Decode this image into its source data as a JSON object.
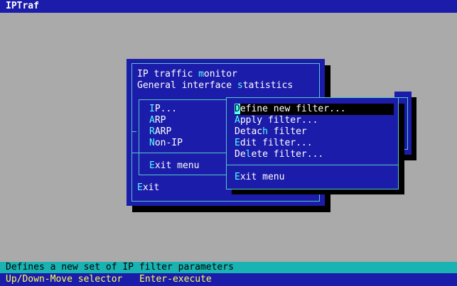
{
  "app_title": "IPTraf",
  "main_menu": {
    "items": [
      {
        "hotkey": "",
        "label": "IP traffic ",
        "hk2": "m",
        "rest": "onitor"
      },
      {
        "label": "General interface ",
        "hk2": "s",
        "rest": "tatistics"
      }
    ],
    "exit_hotkey": "E",
    "exit_rest": "xit"
  },
  "protocol_menu": {
    "items": [
      {
        "hotkey": "I",
        "rest": "P..."
      },
      {
        "hotkey": "A",
        "rest": "RP"
      },
      {
        "hotkey": "R",
        "rest": "ARP"
      },
      {
        "hotkey": "N",
        "rest": "on-IP"
      }
    ],
    "exit_hotkey": "E",
    "exit_rest": "xit menu"
  },
  "filter_menu": {
    "items": [
      {
        "hotkey": "D",
        "rest": "efine new filter..."
      },
      {
        "hotkey": "A",
        "rest": "pply filter..."
      },
      {
        "pre": "Detac",
        "hotkey": "h",
        "rest": " filter"
      },
      {
        "hotkey": "E",
        "rest": "dit filter..."
      },
      {
        "pre": "De",
        "hotkey": "l",
        "rest": "ete filter..."
      }
    ],
    "selected_index": 0,
    "exit_hotkey": "E",
    "exit_rest": "xit menu"
  },
  "status_text": "Defines a new set of IP filter parameters",
  "hints": [
    "Up/Down-Move selector",
    "Enter-execute"
  ],
  "colors": {
    "background": "#aaaaaa",
    "panel": "#1c1caa",
    "border": "#55c8c8",
    "hotkey": "#55ffff",
    "status_bar": "#1ab3b3",
    "hint_text": "#ffff55"
  }
}
